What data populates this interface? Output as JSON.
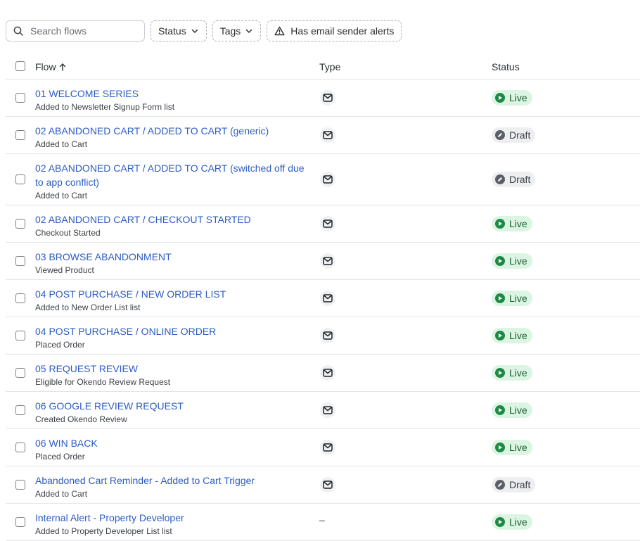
{
  "toolbar": {
    "search_placeholder": "Search flows",
    "status_filter": "Status",
    "tags_filter": "Tags",
    "alerts_filter": "Has email sender alerts"
  },
  "columns": {
    "flow": "Flow",
    "type": "Type",
    "status": "Status"
  },
  "rows": [
    {
      "name": "01 WELCOME SERIES",
      "trigger": "Added to Newsletter Signup Form list",
      "type": "email",
      "status": "Live"
    },
    {
      "name": "02 ABANDONED CART / ADDED TO CART (generic)",
      "trigger": "Added to Cart",
      "type": "email",
      "status": "Draft"
    },
    {
      "name": "02 ABANDONED CART / ADDED TO CART (switched off due to app conflict)",
      "trigger": "Added to Cart",
      "type": "email",
      "status": "Draft"
    },
    {
      "name": "02 ABANDONED CART / CHECKOUT STARTED",
      "trigger": "Checkout Started",
      "type": "email",
      "status": "Live"
    },
    {
      "name": "03 BROWSE ABANDONMENT",
      "trigger": "Viewed Product",
      "type": "email",
      "status": "Live"
    },
    {
      "name": "04 POST PURCHASE / NEW ORDER LIST",
      "trigger": "Added to New Order List list",
      "type": "email",
      "status": "Live"
    },
    {
      "name": "04 POST PURCHASE / ONLINE ORDER",
      "trigger": "Placed Order",
      "type": "email",
      "status": "Live"
    },
    {
      "name": "05 REQUEST REVIEW",
      "trigger": "Eligible for Okendo Review Request",
      "type": "email",
      "status": "Live"
    },
    {
      "name": "06 GOOGLE REVIEW REQUEST",
      "trigger": "Created Okendo Review",
      "type": "email",
      "status": "Live"
    },
    {
      "name": "06 WIN BACK",
      "trigger": "Placed Order",
      "type": "email",
      "status": "Live"
    },
    {
      "name": "Abandoned Cart Reminder - Added to Cart Trigger",
      "trigger": "Added to Cart",
      "type": "email",
      "status": "Draft"
    },
    {
      "name": "Internal Alert - Property Developer",
      "trigger": "Added to Property Developer List list",
      "type": "–",
      "status": "Live"
    }
  ]
}
